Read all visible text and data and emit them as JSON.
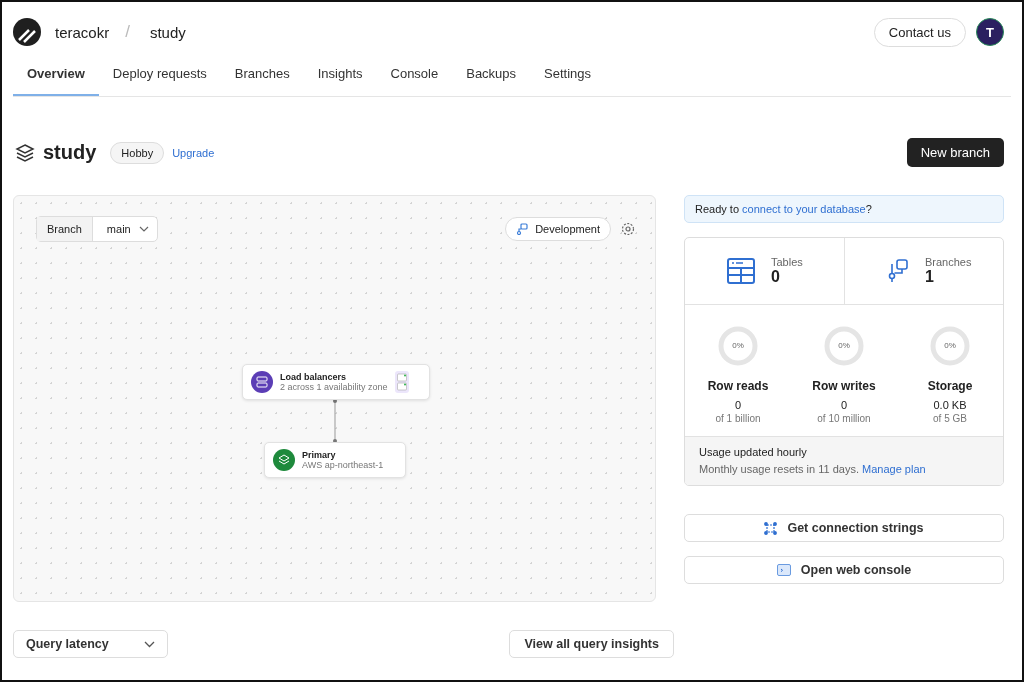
{
  "header": {
    "org": "teracokr",
    "separator": "/",
    "database": "study",
    "contact": "Contact us",
    "avatar_letter": "T"
  },
  "tabs": [
    {
      "label": "Overview",
      "selected": true
    },
    {
      "label": "Deploy requests",
      "selected": false
    },
    {
      "label": "Branches",
      "selected": false
    },
    {
      "label": "Insights",
      "selected": false
    },
    {
      "label": "Console",
      "selected": false
    },
    {
      "label": "Backups",
      "selected": false
    },
    {
      "label": "Settings",
      "selected": false
    }
  ],
  "title": {
    "name": "study",
    "plan": "Hobby",
    "upgrade": "Upgrade",
    "new_branch": "New branch"
  },
  "canvas": {
    "branch_label": "Branch",
    "branch_value": "main",
    "environment": "Development",
    "nodes": [
      {
        "kind": "balancer",
        "title": "Load balancers",
        "subtitle": "2 across 1 availability zone"
      },
      {
        "kind": "primary",
        "title": "Primary",
        "subtitle": "AWS ap-northeast-1"
      }
    ]
  },
  "connect_banner": {
    "before": "Ready to ",
    "link": "connect to your database",
    "after": "?"
  },
  "stats": [
    {
      "kind": "tables",
      "label": "Tables",
      "value": "0"
    },
    {
      "kind": "branches",
      "label": "Branches",
      "value": "1"
    }
  ],
  "usage": [
    {
      "percent": "0%",
      "level": 0,
      "label": "Row reads",
      "value": "0",
      "limit": "of 1 billion"
    },
    {
      "percent": "0%",
      "level": 0,
      "label": "Row writes",
      "value": "0",
      "limit": "of 10 million"
    },
    {
      "percent": "0%",
      "level": 0,
      "label": "Storage",
      "value": "0.0 KB",
      "limit": "of 5 GB"
    }
  ],
  "usage_footer": {
    "title": "Usage updated hourly",
    "note": "Monthly usage resets in 11 days.",
    "link": "Manage plan"
  },
  "actions": [
    {
      "kind": "connection",
      "label": "Get connection strings"
    },
    {
      "kind": "console",
      "label": "Open web console"
    }
  ],
  "insights": {
    "metric": "Query latency",
    "view_all": "View all query insights"
  }
}
